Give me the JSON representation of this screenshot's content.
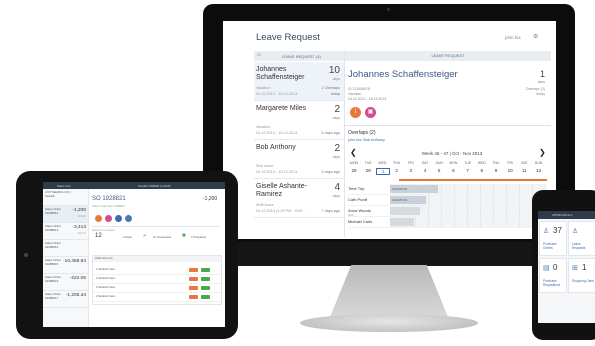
{
  "monitor": {
    "app_title": "Leave Request",
    "user_name": "john.fox",
    "list_header": "LEAVE REQUEST (4)",
    "detail_header": "LEAVE REQUEST",
    "requests": [
      {
        "name": "Johannes Schaffensteiger",
        "days": "10",
        "days_label": "days",
        "type": "Vacation",
        "dates": "04.12.2013 - 16.12.2013",
        "note_top": "2 Overlaps",
        "note": "today"
      },
      {
        "name": "Margarete Miles",
        "days": "2",
        "days_label": "days",
        "type": "Vacation",
        "dates": "04.12.2013 - 16.12.2013",
        "note": "5 days ago"
      },
      {
        "name": "Bob Anthony",
        "days": "2",
        "days_label": "days",
        "type": "Sick leave",
        "dates": "04.12.2013 - 16.12.2013",
        "note": "3 days ago"
      },
      {
        "name": "Giselle Ashante-Ramirez",
        "days": "4",
        "days_label": "days",
        "type": "Shift leave",
        "dates": "04.12.2013 (1:00 PM - 5:00 ...",
        "note": "7 days ago"
      }
    ],
    "detail": {
      "name": "Johannes Schaffensteiger",
      "days": "1",
      "days_label": "days",
      "id": "ID 123456678",
      "type": "Vacation",
      "dates": "04.12.2013 - 16.12.2013",
      "overlaps": "Overlaps (2)",
      "overlaps_when": "today",
      "overlaps_title": "Overlaps (2)",
      "overlaps_names": "john.fox, Bob Anthony",
      "week": "Week 46 - 47 | Oct - Nov 2013",
      "weekdays": [
        "MON",
        "TUE",
        "WED",
        "THU",
        "FRI",
        "SAT",
        "SUN",
        "MON",
        "TUE",
        "WED",
        "THU",
        "FRI",
        "SAT",
        "SUN"
      ],
      "daynums": [
        "28",
        "29",
        "1",
        "2",
        "3",
        "4",
        "5",
        "6",
        "7",
        "8",
        "9",
        "10",
        "11",
        "12"
      ],
      "gantt": [
        {
          "name": "Time Trip",
          "sub": "",
          "block": "VACATION"
        },
        {
          "name": "Cath Purdf",
          "sub": "",
          "block": "VACATION"
        },
        {
          "name": "Anna Woods",
          "sub": "Sick",
          "block": ""
        },
        {
          "name": "Michael Carls",
          "sub": "",
          "block": ""
        }
      ]
    }
  },
  "tablet": {
    "top_left": "Sales Ord...",
    "top_right": "SALES ORDER (12345)",
    "list": [
      {
        "label": "LIST SEARCH (2) | SALES",
        "value": "",
        "sub": ""
      },
      {
        "label": "Sales Order 19288012",
        "value": "-1,200",
        "sub": "Feb 12"
      },
      {
        "label": "Sales Order 19288013",
        "value": "-3,413",
        "sub": "Feb 12"
      },
      {
        "label": "Sales Order 19288014",
        "value": "",
        "sub": ""
      },
      {
        "label": "Sales Order 19288015",
        "value": "-10,458.94",
        "sub": ""
      },
      {
        "label": "Sales Order 19288016",
        "value": "-222.05",
        "sub": ""
      },
      {
        "label": "Sales Order 19288017",
        "value": "-1,205.44",
        "sub": ""
      }
    ],
    "so_title": "SO 1928821",
    "so_amount": "-1,200",
    "so_sub": "Sales Order Item 1928821",
    "fulfil_label": "Delivery Complete",
    "stat_big": "12",
    "stat_days": "3 days",
    "stat_proc": "3+ Processes",
    "stat_ship": "7 Prepared",
    "table_header": "Order items (4)",
    "rows": [
      "1 Sandwich Item",
      "2 Sandwich Item",
      "3 Sandwich Item",
      "4 Sandwich Item"
    ]
  },
  "phone": {
    "title": "APPROVE ALL",
    "tiles": [
      {
        "icon": "people-icon",
        "count": "37",
        "label": "Purchase Orders"
      },
      {
        "icon": "people-icon",
        "count": "",
        "label": "Leave Requests"
      },
      {
        "icon": "clipboard-icon",
        "count": "0",
        "label": "Purchase Requisitions"
      },
      {
        "icon": "cart-icon",
        "count": "1",
        "label": "Shopping Carts"
      }
    ]
  },
  "colors": {
    "accent_orange": "#e9783e",
    "accent_pink": "#d64a8e",
    "link_blue": "#3b6ab1",
    "title_blue": "#3c5a86"
  }
}
